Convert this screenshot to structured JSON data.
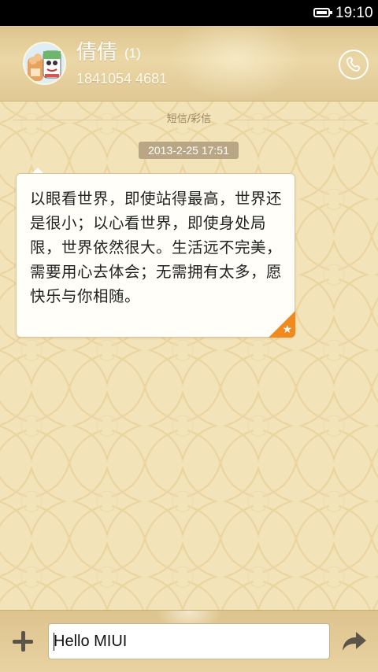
{
  "status_bar": {
    "time": "19:10",
    "battery_icon": "battery-icon"
  },
  "header": {
    "contact_name": "倩倩",
    "unread_count": "(1)",
    "phone_number": "1841054 4681",
    "call_icon": "phone-icon",
    "avatar_icon": "cartoon-avatar"
  },
  "conversation": {
    "channel_label": "短信/彩信",
    "messages": [
      {
        "timestamp": "2013-2-25 17:51",
        "text": "以眼看世界，即使站得最高，世界还是很小；以心看世界，即使身处局限，世界依然很大。生活远不完美，需要用心去体会；无需拥有太多，愿快乐与你相随。",
        "badge_icon": "star-icon"
      }
    ]
  },
  "compose": {
    "attach_icon": "plus-icon",
    "input_value": "Hello MIUI",
    "send_icon": "send-arrow-icon"
  },
  "colors": {
    "status_bar": "#000000",
    "background": "#f3e3b8",
    "header": "#e2cc98",
    "star_badge": "#f08a1e"
  }
}
